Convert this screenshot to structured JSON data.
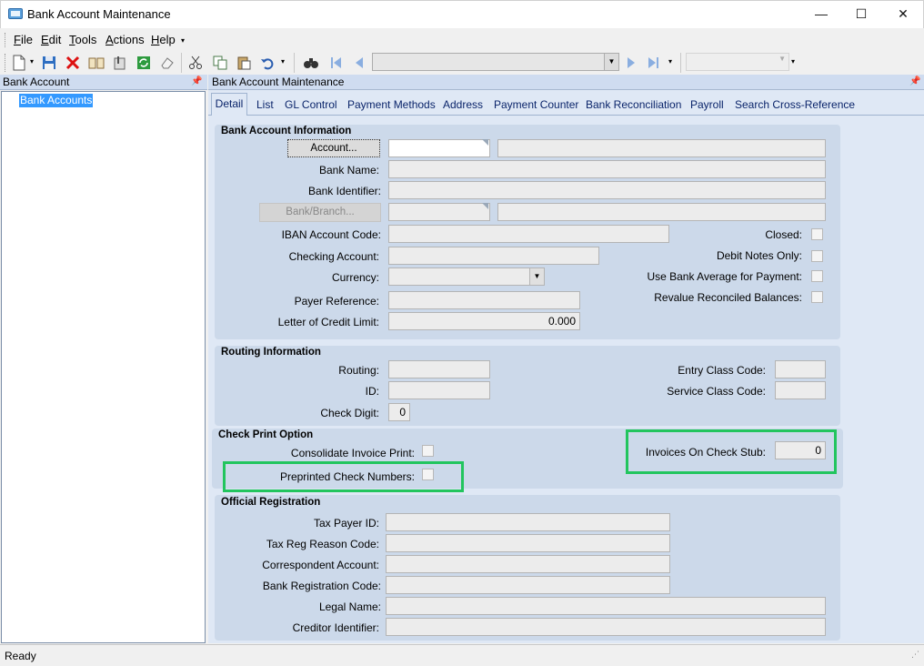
{
  "window": {
    "title": "Bank Account Maintenance",
    "minimize_glyph": "—",
    "maximize_glyph": "☐",
    "close_glyph": "✕"
  },
  "menu": {
    "file": "File",
    "edit": "Edit",
    "tools": "Tools",
    "actions": "Actions",
    "help": "Help"
  },
  "left_panel": {
    "title": "Bank Account",
    "tree_item": "Bank Accounts"
  },
  "right_panel": {
    "title": "Bank Account Maintenance"
  },
  "tabs": [
    "Detail",
    "List",
    "GL Control",
    "Payment Methods",
    "Address",
    "Payment Counter",
    "Bank Reconciliation",
    "Payroll",
    "Search Cross-Reference"
  ],
  "bank_info": {
    "title": "Bank Account Information",
    "account_button": "Account...",
    "bank_name_label": "Bank Name:",
    "bank_identifier_label": "Bank Identifier:",
    "bank_branch_button": "Bank/Branch...",
    "iban_label": "IBAN Account Code:",
    "checking_label": "Checking Account:",
    "currency_label": "Currency:",
    "payer_ref_label": "Payer Reference:",
    "loc_limit_label": "Letter of Credit Limit:",
    "loc_limit_value": "0.000",
    "closed_label": "Closed:",
    "debit_notes_label": "Debit Notes Only:",
    "bank_avg_label": "Use Bank Average for Payment:",
    "revalue_label": "Revalue Reconciled Balances:"
  },
  "routing": {
    "title": "Routing Information",
    "routing_label": "Routing:",
    "id_label": "ID:",
    "check_digit_label": "Check Digit:",
    "check_digit_value": "0",
    "entry_class_label": "Entry Class Code:",
    "service_class_label": "Service Class Code:"
  },
  "check_print": {
    "title": "Check Print Option",
    "consolidate_label": "Consolidate Invoice Print:",
    "preprinted_label": "Preprinted Check Numbers:",
    "invoices_stub_label": "Invoices On Check Stub:",
    "invoices_stub_value": "0"
  },
  "official": {
    "title": "Official Registration",
    "tax_payer_label": "Tax Payer ID:",
    "tax_reg_label": "Tax Reg Reason Code:",
    "correspondent_label": "Correspondent Account:",
    "bank_reg_label": "Bank Registration Code:",
    "legal_name_label": "Legal Name:",
    "creditor_label": "Creditor Identifier:"
  },
  "status": {
    "text": "Ready"
  },
  "colors": {
    "highlight": "#22c55e",
    "selection": "#3399ff",
    "tab_text": "#0a246a"
  }
}
